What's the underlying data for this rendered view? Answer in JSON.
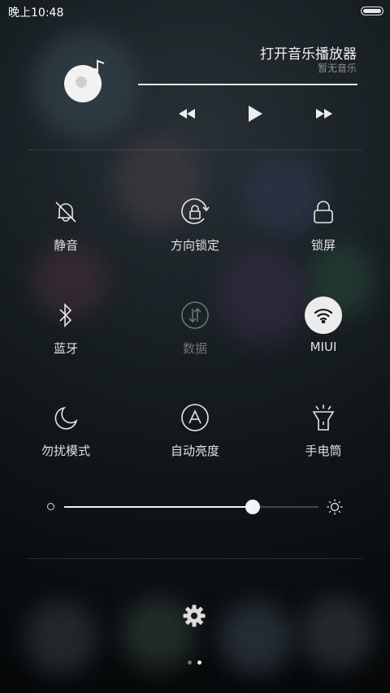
{
  "status_bar": {
    "time": "晚上10:48",
    "battery_level": 1.0
  },
  "music": {
    "title": "打开音乐播放器",
    "subtitle": "暂无音乐",
    "progress": 1.0,
    "icons": {
      "album": "music-disc-icon",
      "previous": "previous-icon",
      "play": "play-icon",
      "next": "next-icon"
    }
  },
  "toggles": [
    {
      "label": "静音",
      "icon": "silent-bell-icon",
      "state": "off"
    },
    {
      "label": "方向锁定",
      "icon": "rotation-lock-icon",
      "state": "off"
    },
    {
      "label": "锁屏",
      "icon": "lock-icon",
      "state": "off"
    },
    {
      "label": "蓝牙",
      "icon": "bluetooth-icon",
      "state": "off"
    },
    {
      "label": "数据",
      "icon": "mobile-data-icon",
      "state": "disabled"
    },
    {
      "label": "MIUI",
      "icon": "wifi-icon",
      "state": "on"
    },
    {
      "label": "勿扰模式",
      "icon": "moon-icon",
      "state": "off"
    },
    {
      "label": "自动亮度",
      "icon": "auto-brightness-icon",
      "state": "off"
    },
    {
      "label": "手电筒",
      "icon": "flashlight-icon",
      "state": "off"
    }
  ],
  "brightness": {
    "level": 0.74
  },
  "settings_icon": "gear-icon",
  "pages": {
    "count": 2,
    "current": 2
  }
}
